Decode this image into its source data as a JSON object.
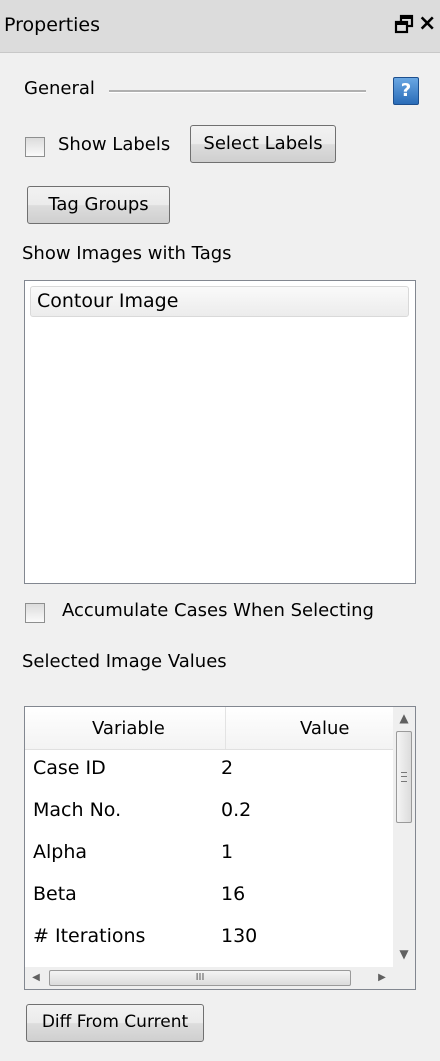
{
  "panel": {
    "title": "Properties",
    "float_icon": "float-window-icon",
    "close_glyph": "×"
  },
  "general": {
    "label": "General",
    "help_glyph": "?"
  },
  "show_labels": {
    "label": "Show Labels",
    "checked": false
  },
  "buttons": {
    "select_labels": "Select Labels",
    "tag_groups": "Tag Groups",
    "diff_from_current": "Diff From Current"
  },
  "tags_section": {
    "label": "Show Images with Tags",
    "items": [
      "Contour Image"
    ]
  },
  "accumulate": {
    "label": "Accumulate Cases When Selecting",
    "checked": false
  },
  "values_section": {
    "label": "Selected Image Values",
    "columns": [
      "Variable",
      "Value"
    ],
    "rows": [
      {
        "variable": "Case ID",
        "value": "2"
      },
      {
        "variable": "Mach No.",
        "value": "0.2"
      },
      {
        "variable": "Alpha",
        "value": "1"
      },
      {
        "variable": "Beta",
        "value": "16"
      },
      {
        "variable": "# Iterations",
        "value": "130"
      }
    ]
  },
  "scrollbars": {
    "up_glyph": "▲",
    "down_glyph": "▼",
    "left_glyph": "◀",
    "right_glyph": "▶",
    "thumb_grip": "III"
  }
}
